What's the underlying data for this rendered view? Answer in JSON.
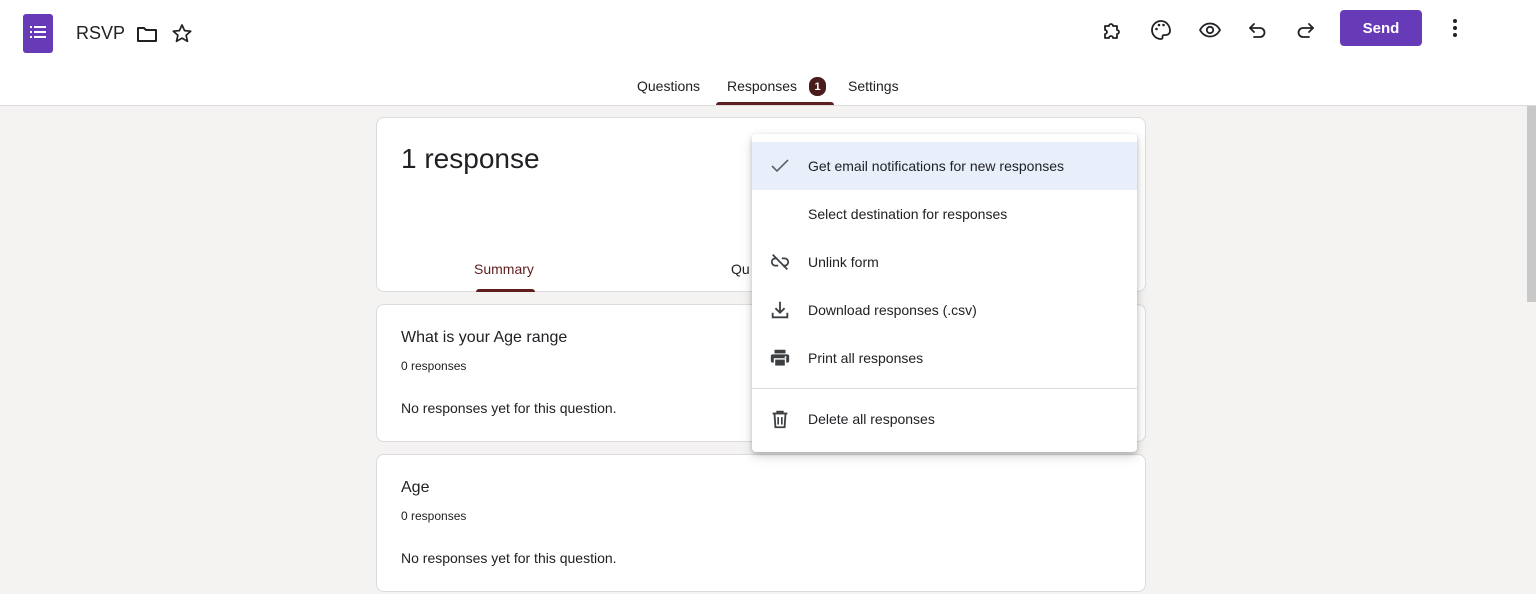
{
  "header": {
    "title": "RSVP",
    "send_label": "Send"
  },
  "tabs": [
    {
      "label": "Questions"
    },
    {
      "label": "Responses",
      "badge": "1"
    },
    {
      "label": "Settings"
    }
  ],
  "summary": {
    "response_count": "1 response",
    "subtabs": [
      "Summary",
      "Qu"
    ]
  },
  "questions": [
    {
      "title": "What is your Age range",
      "count": "0 responses",
      "empty": "No responses yet for this question."
    },
    {
      "title": "Age",
      "count": "0 responses",
      "empty": "No responses yet for this question."
    }
  ],
  "menu": {
    "items": [
      {
        "label": "Get email notifications for new responses",
        "icon": "check-icon",
        "selected": true
      },
      {
        "label": "Select destination for responses",
        "icon": ""
      },
      {
        "label": "Unlink form",
        "icon": "unlink-icon"
      },
      {
        "label": "Download responses (.csv)",
        "icon": "download-icon"
      },
      {
        "label": "Print all responses",
        "icon": "print-icon"
      },
      {
        "label": "Delete all responses",
        "icon": "trash-icon"
      }
    ]
  },
  "colors": {
    "accent": "#673ab7",
    "tab_accent": "#5f1e1e",
    "background": "#f4f3f1",
    "menu_selected": "#e8effb"
  }
}
